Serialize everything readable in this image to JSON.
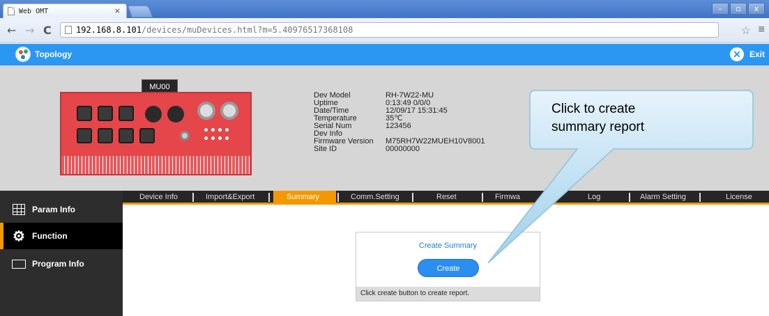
{
  "browser": {
    "tab_title": "Web OMT",
    "tab_close": "×",
    "url_host": "192.168.8.101",
    "url_path": "/devices/muDevices.html?m=5.40976517368108",
    "window_controls": [
      "–",
      "▫",
      "x"
    ]
  },
  "header": {
    "topology_label": "Topology",
    "exit_label": "Exit"
  },
  "device": {
    "badge": "MU00",
    "info": [
      {
        "key": "Dev Model",
        "value": "RH-7W22-MU"
      },
      {
        "key": "Uptime",
        "value": "0:13:49 0/0/0"
      },
      {
        "key": "Date/Time",
        "value": "12/09/17 15:31:45"
      },
      {
        "key": "Temperature",
        "value": "35℃"
      },
      {
        "key": "Serial Num",
        "value": "123456"
      },
      {
        "key": "Dev Info",
        "value": ""
      },
      {
        "key": "Firmware Version",
        "value": "M75RH7W22MUEH10V8001"
      },
      {
        "key": "Site ID",
        "value": "00000000"
      }
    ]
  },
  "tabs": [
    "Device Info",
    "Import&Export",
    "Summary",
    "Comm.Setting",
    "Reset",
    "Firmwa",
    "Log",
    "Alarm Setting",
    "License"
  ],
  "active_tab": "Summary",
  "sidebar": {
    "items": [
      {
        "label": "Param Info",
        "icon": "grid-icon"
      },
      {
        "label": "Function",
        "icon": "gear-icon"
      },
      {
        "label": "Program Info",
        "icon": "program-icon"
      }
    ],
    "active": "Function"
  },
  "summary": {
    "title": "Create Summary",
    "button": "Create",
    "hint": "Click create button to create report."
  },
  "callout": {
    "line1": "Click to create",
    "line2": "summary report"
  },
  "colors": {
    "header_blue": "#2b97f2",
    "accent_orange": "#f39800",
    "device_red": "#e4464a",
    "sidebar_dark": "#2d2d2d"
  }
}
